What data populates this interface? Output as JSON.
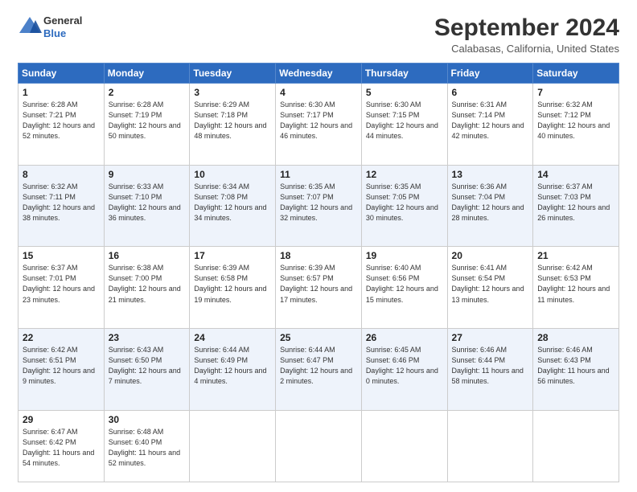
{
  "logo": {
    "line1": "General",
    "line2": "Blue"
  },
  "title": "September 2024",
  "location": "Calabasas, California, United States",
  "weekdays": [
    "Sunday",
    "Monday",
    "Tuesday",
    "Wednesday",
    "Thursday",
    "Friday",
    "Saturday"
  ],
  "weeks": [
    [
      {
        "day": "1",
        "sunrise": "6:28 AM",
        "sunset": "7:21 PM",
        "daylight": "12 hours and 52 minutes."
      },
      {
        "day": "2",
        "sunrise": "6:28 AM",
        "sunset": "7:19 PM",
        "daylight": "12 hours and 50 minutes."
      },
      {
        "day": "3",
        "sunrise": "6:29 AM",
        "sunset": "7:18 PM",
        "daylight": "12 hours and 48 minutes."
      },
      {
        "day": "4",
        "sunrise": "6:30 AM",
        "sunset": "7:17 PM",
        "daylight": "12 hours and 46 minutes."
      },
      {
        "day": "5",
        "sunrise": "6:30 AM",
        "sunset": "7:15 PM",
        "daylight": "12 hours and 44 minutes."
      },
      {
        "day": "6",
        "sunrise": "6:31 AM",
        "sunset": "7:14 PM",
        "daylight": "12 hours and 42 minutes."
      },
      {
        "day": "7",
        "sunrise": "6:32 AM",
        "sunset": "7:12 PM",
        "daylight": "12 hours and 40 minutes."
      }
    ],
    [
      {
        "day": "8",
        "sunrise": "6:32 AM",
        "sunset": "7:11 PM",
        "daylight": "12 hours and 38 minutes."
      },
      {
        "day": "9",
        "sunrise": "6:33 AM",
        "sunset": "7:10 PM",
        "daylight": "12 hours and 36 minutes."
      },
      {
        "day": "10",
        "sunrise": "6:34 AM",
        "sunset": "7:08 PM",
        "daylight": "12 hours and 34 minutes."
      },
      {
        "day": "11",
        "sunrise": "6:35 AM",
        "sunset": "7:07 PM",
        "daylight": "12 hours and 32 minutes."
      },
      {
        "day": "12",
        "sunrise": "6:35 AM",
        "sunset": "7:05 PM",
        "daylight": "12 hours and 30 minutes."
      },
      {
        "day": "13",
        "sunrise": "6:36 AM",
        "sunset": "7:04 PM",
        "daylight": "12 hours and 28 minutes."
      },
      {
        "day": "14",
        "sunrise": "6:37 AM",
        "sunset": "7:03 PM",
        "daylight": "12 hours and 26 minutes."
      }
    ],
    [
      {
        "day": "15",
        "sunrise": "6:37 AM",
        "sunset": "7:01 PM",
        "daylight": "12 hours and 23 minutes."
      },
      {
        "day": "16",
        "sunrise": "6:38 AM",
        "sunset": "7:00 PM",
        "daylight": "12 hours and 21 minutes."
      },
      {
        "day": "17",
        "sunrise": "6:39 AM",
        "sunset": "6:58 PM",
        "daylight": "12 hours and 19 minutes."
      },
      {
        "day": "18",
        "sunrise": "6:39 AM",
        "sunset": "6:57 PM",
        "daylight": "12 hours and 17 minutes."
      },
      {
        "day": "19",
        "sunrise": "6:40 AM",
        "sunset": "6:56 PM",
        "daylight": "12 hours and 15 minutes."
      },
      {
        "day": "20",
        "sunrise": "6:41 AM",
        "sunset": "6:54 PM",
        "daylight": "12 hours and 13 minutes."
      },
      {
        "day": "21",
        "sunrise": "6:42 AM",
        "sunset": "6:53 PM",
        "daylight": "12 hours and 11 minutes."
      }
    ],
    [
      {
        "day": "22",
        "sunrise": "6:42 AM",
        "sunset": "6:51 PM",
        "daylight": "12 hours and 9 minutes."
      },
      {
        "day": "23",
        "sunrise": "6:43 AM",
        "sunset": "6:50 PM",
        "daylight": "12 hours and 7 minutes."
      },
      {
        "day": "24",
        "sunrise": "6:44 AM",
        "sunset": "6:49 PM",
        "daylight": "12 hours and 4 minutes."
      },
      {
        "day": "25",
        "sunrise": "6:44 AM",
        "sunset": "6:47 PM",
        "daylight": "12 hours and 2 minutes."
      },
      {
        "day": "26",
        "sunrise": "6:45 AM",
        "sunset": "6:46 PM",
        "daylight": "12 hours and 0 minutes."
      },
      {
        "day": "27",
        "sunrise": "6:46 AM",
        "sunset": "6:44 PM",
        "daylight": "11 hours and 58 minutes."
      },
      {
        "day": "28",
        "sunrise": "6:46 AM",
        "sunset": "6:43 PM",
        "daylight": "11 hours and 56 minutes."
      }
    ],
    [
      {
        "day": "29",
        "sunrise": "6:47 AM",
        "sunset": "6:42 PM",
        "daylight": "11 hours and 54 minutes."
      },
      {
        "day": "30",
        "sunrise": "6:48 AM",
        "sunset": "6:40 PM",
        "daylight": "11 hours and 52 minutes."
      },
      null,
      null,
      null,
      null,
      null
    ]
  ]
}
